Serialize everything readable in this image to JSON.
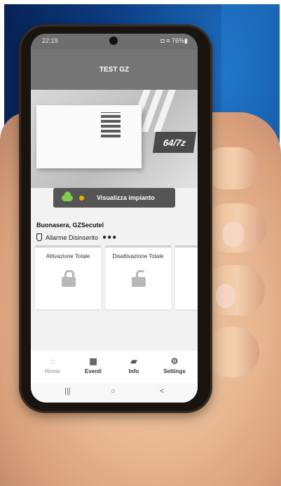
{
  "statusbar": {
    "time": "22:19",
    "battery": "76%",
    "icons_text": "◘ ≡ 76%▮"
  },
  "header": {
    "title": "TEST GZ"
  },
  "hero": {
    "badge_text": "64/7z"
  },
  "view_button": {
    "label": "Visualizza impianto"
  },
  "greeting": "Buonasera, GZSecutel",
  "alarm_state": {
    "label": "Allarme Disinserito",
    "dots": "●●●"
  },
  "cards": [
    {
      "title": "Attivazione Totale",
      "icon": "lock-closed-icon"
    },
    {
      "title": "Disattivazione Totale",
      "icon": "lock-open-icon"
    }
  ],
  "tabs": [
    {
      "label": "Home",
      "icon": "home-icon",
      "glyph": "⌂"
    },
    {
      "label": "Eventi",
      "icon": "calendar-icon",
      "glyph": "▦"
    },
    {
      "label": "Info",
      "icon": "info-logo-icon",
      "glyph": "▰"
    },
    {
      "label": "Settings",
      "icon": "gear-icon",
      "glyph": "⚙"
    }
  ],
  "navbar": {
    "recents": "|||",
    "home": "○",
    "back": "<"
  },
  "colors": {
    "header": "#757575",
    "badge": "#4a4a4a",
    "cloud": "#7fcf4a",
    "status_dot": "#f6a800"
  }
}
